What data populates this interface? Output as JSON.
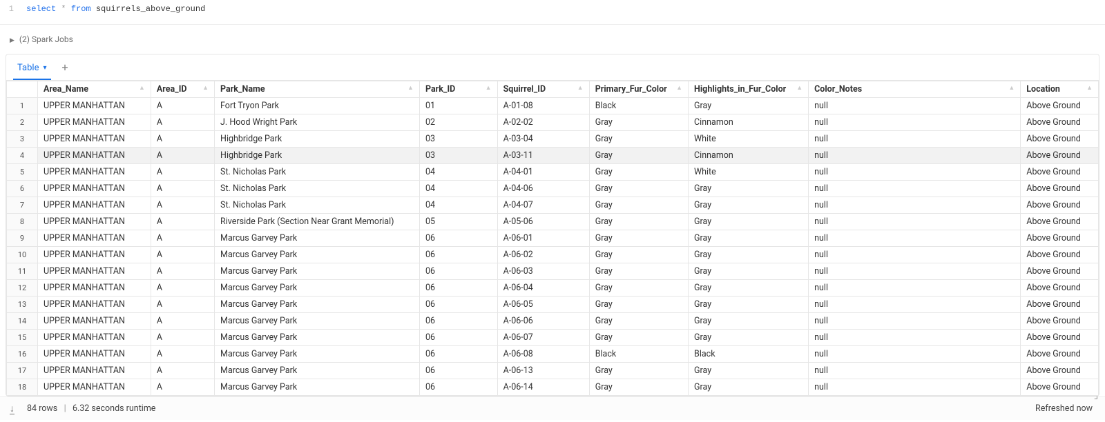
{
  "code": {
    "line_number": "1",
    "kw_select": "select",
    "star": " * ",
    "kw_from": "from",
    "table_name": " squirrels_above_ground"
  },
  "spark_jobs": {
    "label": "(2) Spark Jobs"
  },
  "tabs": {
    "active": "Table"
  },
  "columns": [
    "Area_Name",
    "Area_ID",
    "Park_Name",
    "Park_ID",
    "Squirrel_ID",
    "Primary_Fur_Color",
    "Highlights_in_Fur_Color",
    "Color_Notes",
    "Location"
  ],
  "rows": [
    [
      "UPPER MANHATTAN",
      "A",
      "Fort Tryon Park",
      "01",
      "A-01-08",
      "Black",
      "Gray",
      "null",
      "Above Ground"
    ],
    [
      "UPPER MANHATTAN",
      "A",
      "J. Hood Wright Park",
      "02",
      "A-02-02",
      "Gray",
      "Cinnamon",
      "null",
      "Above Ground"
    ],
    [
      "UPPER MANHATTAN",
      "A",
      "Highbridge Park",
      "03",
      "A-03-04",
      "Gray",
      "White",
      "null",
      "Above Ground"
    ],
    [
      "UPPER MANHATTAN",
      "A",
      "Highbridge Park",
      "03",
      "A-03-11",
      "Gray",
      "Cinnamon",
      "null",
      "Above Ground"
    ],
    [
      "UPPER MANHATTAN",
      "A",
      "St. Nicholas Park",
      "04",
      "A-04-01",
      "Gray",
      "White",
      "null",
      "Above Ground"
    ],
    [
      "UPPER MANHATTAN",
      "A",
      "St. Nicholas Park",
      "04",
      "A-04-06",
      "Gray",
      "Gray",
      "null",
      "Above Ground"
    ],
    [
      "UPPER MANHATTAN",
      "A",
      "St. Nicholas Park",
      "04",
      "A-04-07",
      "Gray",
      "Gray",
      "null",
      "Above Ground"
    ],
    [
      "UPPER MANHATTAN",
      "A",
      "Riverside Park (Section Near Grant Memorial)",
      "05",
      "A-05-06",
      "Gray",
      "Gray",
      "null",
      "Above Ground"
    ],
    [
      "UPPER MANHATTAN",
      "A",
      "Marcus Garvey Park",
      "06",
      "A-06-01",
      "Gray",
      "Gray",
      "null",
      "Above Ground"
    ],
    [
      "UPPER MANHATTAN",
      "A",
      "Marcus Garvey Park",
      "06",
      "A-06-02",
      "Gray",
      "Gray",
      "null",
      "Above Ground"
    ],
    [
      "UPPER MANHATTAN",
      "A",
      "Marcus Garvey Park",
      "06",
      "A-06-03",
      "Gray",
      "Gray",
      "null",
      "Above Ground"
    ],
    [
      "UPPER MANHATTAN",
      "A",
      "Marcus Garvey Park",
      "06",
      "A-06-04",
      "Gray",
      "Gray",
      "null",
      "Above Ground"
    ],
    [
      "UPPER MANHATTAN",
      "A",
      "Marcus Garvey Park",
      "06",
      "A-06-05",
      "Gray",
      "Gray",
      "null",
      "Above Ground"
    ],
    [
      "UPPER MANHATTAN",
      "A",
      "Marcus Garvey Park",
      "06",
      "A-06-06",
      "Gray",
      "Gray",
      "null",
      "Above Ground"
    ],
    [
      "UPPER MANHATTAN",
      "A",
      "Marcus Garvey Park",
      "06",
      "A-06-07",
      "Gray",
      "Gray",
      "null",
      "Above Ground"
    ],
    [
      "UPPER MANHATTAN",
      "A",
      "Marcus Garvey Park",
      "06",
      "A-06-08",
      "Black",
      "Black",
      "null",
      "Above Ground"
    ],
    [
      "UPPER MANHATTAN",
      "A",
      "Marcus Garvey Park",
      "06",
      "A-06-13",
      "Gray",
      "Gray",
      "null",
      "Above Ground"
    ],
    [
      "UPPER MANHATTAN",
      "A",
      "Marcus Garvey Park",
      "06",
      "A-06-14",
      "Gray",
      "Gray",
      "null",
      "Above Ground"
    ]
  ],
  "hovered_row_index": 3,
  "status": {
    "rows": "84 rows",
    "runtime": "6.32 seconds runtime",
    "refreshed": "Refreshed now"
  }
}
